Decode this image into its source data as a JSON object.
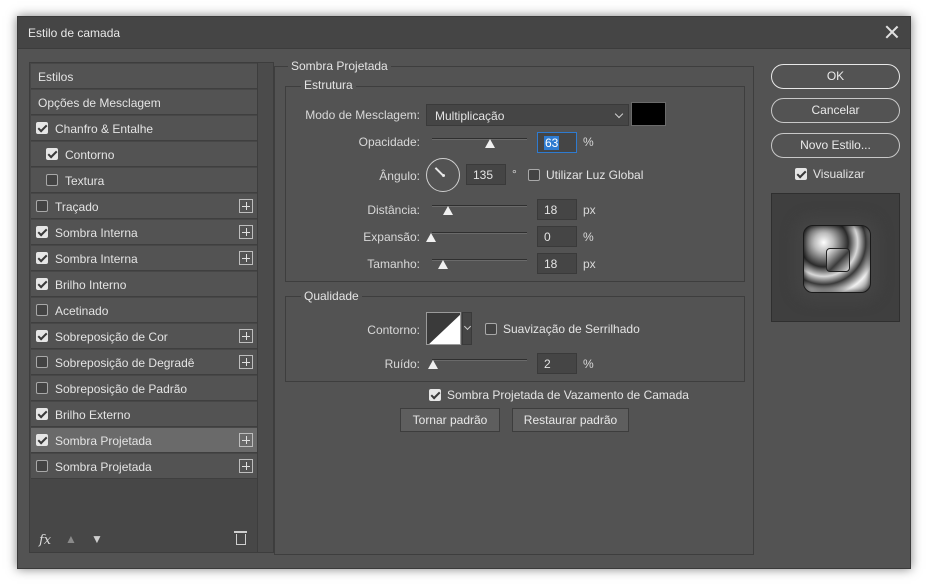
{
  "window": {
    "title": "Estilo de camada",
    "close_icon": "close-icon"
  },
  "sidebar": {
    "items": [
      {
        "label": "Estilos",
        "checkbox": null,
        "plus": false,
        "selected": false
      },
      {
        "label": "Opções de Mesclagem",
        "checkbox": null,
        "plus": false,
        "selected": false
      },
      {
        "label": "Chanfro & Entalhe",
        "checkbox": true,
        "plus": false,
        "selected": false
      },
      {
        "label": "Contorno",
        "checkbox": true,
        "plus": false,
        "selected": false,
        "indent": true
      },
      {
        "label": "Textura",
        "checkbox": false,
        "plus": false,
        "selected": false,
        "indent": true
      },
      {
        "label": "Traçado",
        "checkbox": false,
        "plus": true,
        "selected": false
      },
      {
        "label": "Sombra Interna",
        "checkbox": true,
        "plus": true,
        "selected": false
      },
      {
        "label": "Sombra Interna",
        "checkbox": true,
        "plus": true,
        "selected": false
      },
      {
        "label": "Brilho Interno",
        "checkbox": true,
        "plus": false,
        "selected": false
      },
      {
        "label": "Acetinado",
        "checkbox": false,
        "plus": false,
        "selected": false
      },
      {
        "label": "Sobreposição de Cor",
        "checkbox": true,
        "plus": true,
        "selected": false
      },
      {
        "label": "Sobreposição de Degradê",
        "checkbox": false,
        "plus": true,
        "selected": false
      },
      {
        "label": "Sobreposição de Padrão",
        "checkbox": false,
        "plus": false,
        "selected": false
      },
      {
        "label": "Brilho Externo",
        "checkbox": true,
        "plus": false,
        "selected": false
      },
      {
        "label": "Sombra Projetada",
        "checkbox": true,
        "plus": true,
        "selected": true
      },
      {
        "label": "Sombra Projetada",
        "checkbox": false,
        "plus": true,
        "selected": false
      }
    ],
    "footer": {
      "fx_label": "fx",
      "up_icon": "arrow-up-icon",
      "down_icon": "arrow-down-icon",
      "trash_icon": "trash-icon"
    }
  },
  "main": {
    "section_title": "Sombra Projetada",
    "structure": {
      "title": "Estrutura",
      "blend_mode_label": "Modo de Mesclagem:",
      "blend_mode_value": "Multiplicação",
      "shadow_color": "#000000",
      "opacity_label": "Opacidade:",
      "opacity_value": "63",
      "opacity_unit": "%",
      "opacity_fraction": 0.63,
      "angle_label": "Ângulo:",
      "angle_value": "135",
      "angle_unit": "°",
      "global_light_label": "Utilizar Luz Global",
      "global_light_checked": false,
      "distance_label": "Distância:",
      "distance_value": "18",
      "distance_unit": "px",
      "spread_label": "Expansão:",
      "spread_value": "0",
      "spread_unit": "%",
      "size_label": "Tamanho:",
      "size_value": "18",
      "size_unit": "px"
    },
    "quality": {
      "title": "Qualidade",
      "contour_label": "Contorno:",
      "antialias_label": "Suavização de Serrilhado",
      "antialias_checked": false,
      "noise_label": "Ruído:",
      "noise_value": "2",
      "noise_unit": "%"
    },
    "knockout_label": "Sombra Projetada de Vazamento de Camada",
    "knockout_checked": true,
    "make_default_label": "Tornar padrão",
    "reset_default_label": "Restaurar padrão"
  },
  "actions": {
    "ok_label": "OK",
    "cancel_label": "Cancelar",
    "new_style_label": "Novo Estilo...",
    "preview_label": "Visualizar",
    "preview_checked": true
  }
}
